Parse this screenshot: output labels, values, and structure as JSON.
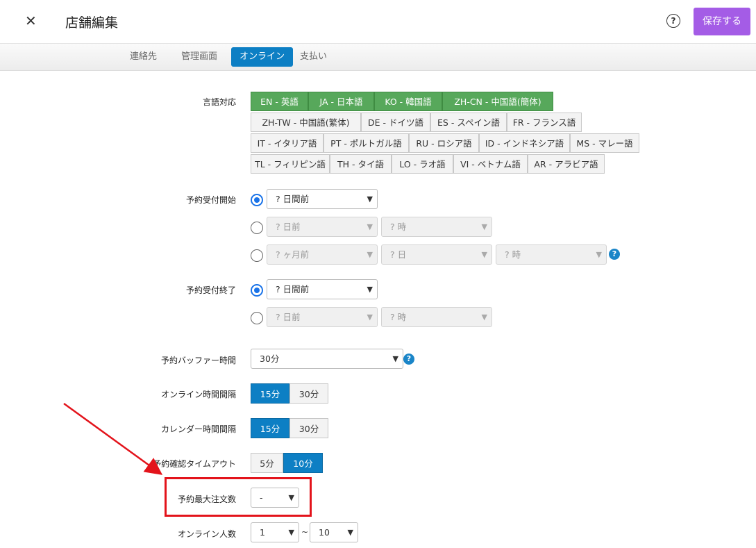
{
  "header": {
    "title": "店舗編集",
    "save_label": "保存する"
  },
  "tabs": [
    "連絡先",
    "管理画面",
    "オンライン",
    "支払い"
  ],
  "labels": {
    "languages": "言語対応",
    "booking_start": "予約受付開始",
    "booking_end": "予約受付終了",
    "buffer": "予約バッファー時間",
    "online_interval": "オンライン時間間隔",
    "calendar_interval": "カレンダー時間間隔",
    "confirm_timeout": "予約確認タイムアウト",
    "max_orders": "予約最大注文数",
    "online_people": "オンライン人数"
  },
  "languages": [
    {
      "label": "EN - 英語",
      "selected": true
    },
    {
      "label": "JA - 日本語",
      "selected": true
    },
    {
      "label": "KO - 韓国語",
      "selected": true
    },
    {
      "label": "ZH-CN - 中国語(簡体)",
      "selected": true
    },
    {
      "label": "ZH-TW - 中国語(繁体)",
      "selected": false
    },
    {
      "label": "DE - ドイツ語",
      "selected": false
    },
    {
      "label": "ES - スペイン語",
      "selected": false
    },
    {
      "label": "FR - フランス語",
      "selected": false
    },
    {
      "label": "IT - イタリア語",
      "selected": false
    },
    {
      "label": "PT - ポルトガル語",
      "selected": false
    },
    {
      "label": "RU - ロシア語",
      "selected": false
    },
    {
      "label": "ID - インドネシア語",
      "selected": false
    },
    {
      "label": "MS - マレー語",
      "selected": false
    },
    {
      "label": "TL - フィリピン語",
      "selected": false
    },
    {
      "label": "TH - タイ語",
      "selected": false
    },
    {
      "label": "LO - ラオ語",
      "selected": false
    },
    {
      "label": "VI - ベトナム語",
      "selected": false
    },
    {
      "label": "AR - アラビア語",
      "selected": false
    }
  ],
  "selects": {
    "start_days_before": "? 日間前",
    "start_day": "? 日前",
    "start_hour": "? 時",
    "start_month": "? ヶ月前",
    "start_month_day": "? 日",
    "start_month_hour": "? 時",
    "end_days_before": "? 日間前",
    "end_day": "? 日前",
    "end_hour": "? 時",
    "buffer": "30分",
    "max_orders": "-",
    "people_min": "1",
    "people_max": "10"
  },
  "segments": {
    "online_interval": [
      "15分",
      "30分"
    ],
    "calendar_interval": [
      "15分",
      "30分"
    ],
    "confirm_timeout": [
      "5分",
      "10分"
    ]
  },
  "tilde": "~",
  "icons": {
    "close": "close-icon",
    "help": "help-circle-icon",
    "chevron": "chevron-down-icon",
    "question": "question-icon"
  },
  "colors": {
    "accent": "#a45ce6",
    "tab_active": "#0d7fc4",
    "lang_selected": "#57a85b",
    "annotation": "#e3131b"
  }
}
